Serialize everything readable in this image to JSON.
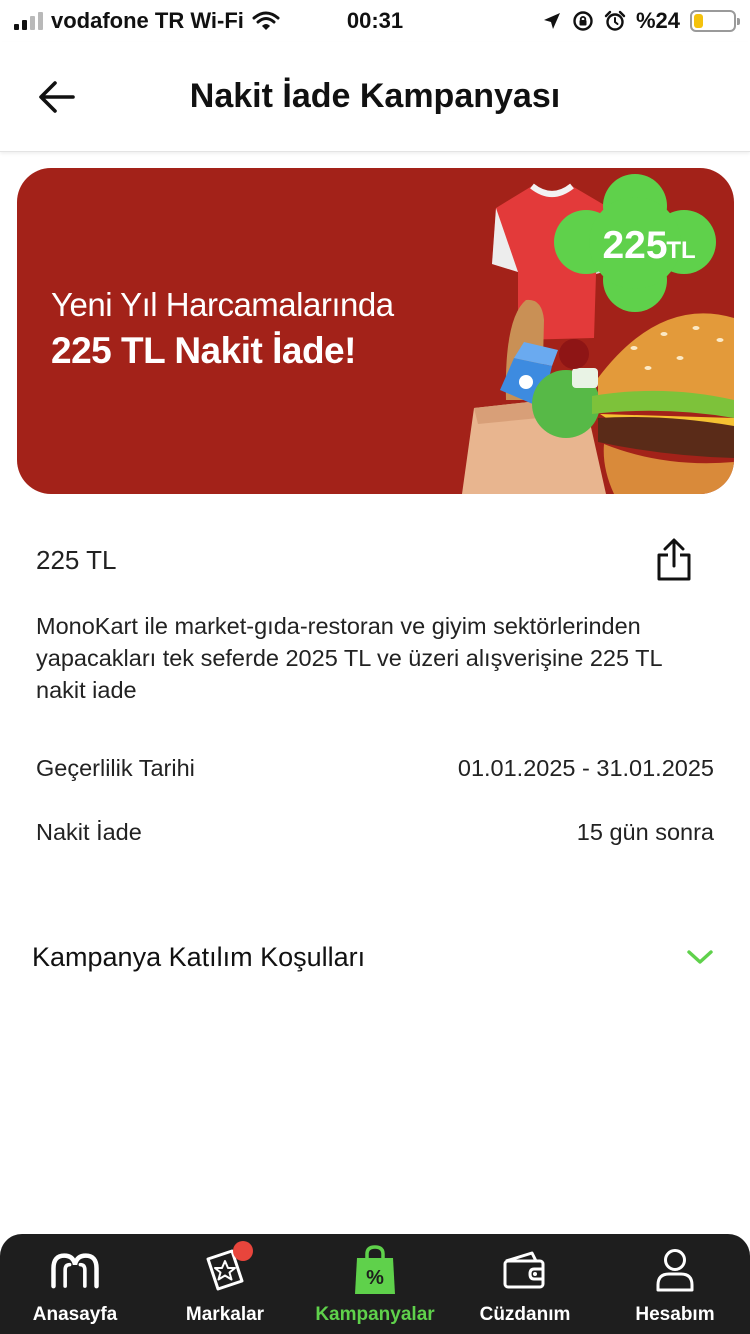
{
  "status_bar": {
    "carrier": "vodafone TR Wi-Fi",
    "time": "00:31",
    "battery_text": "%24",
    "battery_level": 0.24,
    "colors": {
      "battery": "#f4c20d"
    }
  },
  "header": {
    "title": "Nakit İade Kampanyası",
    "back_icon": "arrow-left-icon"
  },
  "banner": {
    "headline": "Yeni Yıl Harcamalarında",
    "highlight": "225 TL Nakit İade!",
    "badge_amount": "225",
    "badge_currency": "TL",
    "colors": {
      "background": "#a32219",
      "badge": "#5fd14b"
    }
  },
  "campaign": {
    "amount": "225 TL",
    "share_icon": "share-icon",
    "description": "MonoKart ile market-gıda-restoran ve giyim sektörlerinden yapacakları tek seferde 2025 TL ve üzeri alışverişine 225 TL nakit iade",
    "validity_label": "Geçerlilik Tarihi",
    "validity_value": "01.01.2025 - 31.01.2025",
    "cashback_label": "Nakit İade",
    "cashback_value": "15 gün sonra",
    "conditions_label": "Kampanya Katılım Koşulları",
    "conditions_icon": "chevron-down-icon"
  },
  "tab_bar": {
    "tabs": [
      {
        "label": "Anasayfa",
        "icon": "home-logo-icon",
        "active": false
      },
      {
        "label": "Markalar",
        "icon": "brands-star-icon",
        "active": false,
        "badge": true
      },
      {
        "label": "Kampanyalar",
        "icon": "campaign-bag-icon",
        "active": true
      },
      {
        "label": "Cüzdanım",
        "icon": "wallet-icon",
        "active": false
      },
      {
        "label": "Hesabım",
        "icon": "user-icon",
        "active": false
      }
    ],
    "colors": {
      "background": "#1e1e1e",
      "active": "#5fd14b",
      "badge": "#e8453c"
    }
  }
}
